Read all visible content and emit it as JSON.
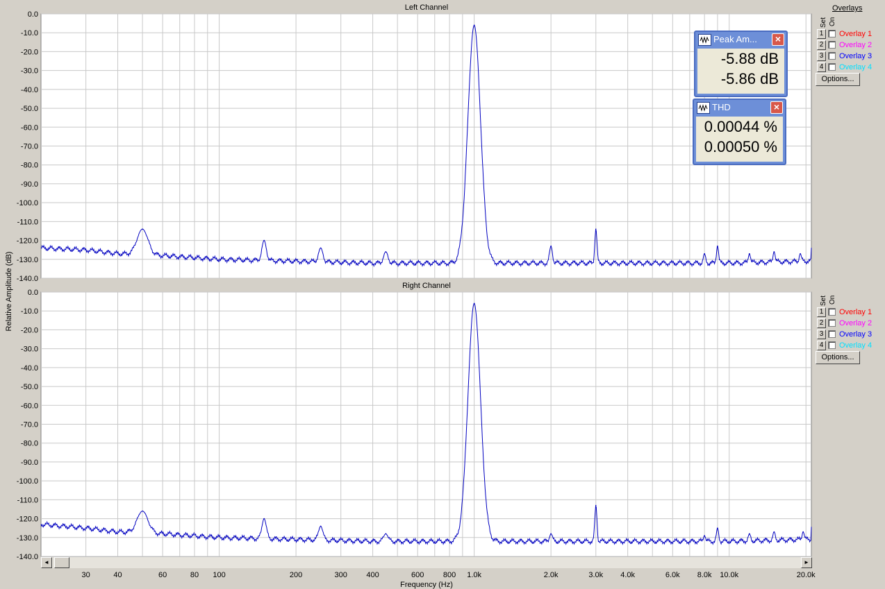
{
  "chart_data": [
    {
      "type": "line",
      "title": "Left Channel",
      "ylabel": "Relative Amplitude (dB)",
      "xscale": "log",
      "xlim": [
        20,
        21000
      ],
      "ylim": [
        -140,
        0
      ],
      "grid": true,
      "series": [
        {
          "name": "",
          "color": "#0000c0",
          "noise": [
            [
              20,
              -124
            ],
            [
              30,
              -125
            ],
            [
              40,
              -127
            ],
            [
              60,
              -128
            ],
            [
              100,
              -130
            ],
            [
              200,
              -131
            ],
            [
              400,
              -132
            ],
            [
              800,
              -132
            ],
            [
              1500,
              -132
            ],
            [
              3000,
              -132
            ],
            [
              6000,
              -132
            ],
            [
              10000,
              -132
            ],
            [
              20000,
              -131
            ],
            [
              21000,
              -131
            ]
          ],
          "peaks": [
            [
              50,
              -114,
              0.03
            ],
            [
              150,
              -120,
              0.012
            ],
            [
              250,
              -124,
              0.012
            ],
            [
              450,
              -126,
              0.012
            ],
            [
              1000,
              -6,
              0.035
            ],
            [
              2000,
              -123,
              0.008
            ],
            [
              3000,
              -114,
              0.006
            ],
            [
              8000,
              -127,
              0.006
            ],
            [
              9000,
              -123,
              0.006
            ],
            [
              12000,
              -127,
              0.006
            ],
            [
              15000,
              -126,
              0.006
            ],
            [
              19000,
              -127,
              0.006
            ]
          ]
        }
      ]
    },
    {
      "type": "line",
      "title": "Right Channel",
      "xlabel": "Frequency (Hz)",
      "ylabel": "Relative Amplitude (dB)",
      "xscale": "log",
      "xlim": [
        20,
        21000
      ],
      "ylim": [
        -140,
        0
      ],
      "grid": true,
      "series": [
        {
          "name": "",
          "color": "#0000c0",
          "noise": [
            [
              20,
              -123
            ],
            [
              30,
              -125
            ],
            [
              40,
              -127
            ],
            [
              60,
              -128
            ],
            [
              100,
              -130
            ],
            [
              200,
              -131
            ],
            [
              400,
              -132
            ],
            [
              800,
              -132
            ],
            [
              1500,
              -132
            ],
            [
              3000,
              -132
            ],
            [
              6000,
              -132
            ],
            [
              10000,
              -132
            ],
            [
              20000,
              -131
            ],
            [
              21000,
              -131
            ]
          ],
          "peaks": [
            [
              50,
              -116,
              0.03
            ],
            [
              150,
              -120,
              0.012
            ],
            [
              250,
              -124,
              0.012
            ],
            [
              450,
              -128,
              0.012
            ],
            [
              1000,
              -6,
              0.035
            ],
            [
              2000,
              -128,
              0.008
            ],
            [
              3000,
              -113,
              0.006
            ],
            [
              8000,
              -129,
              0.006
            ],
            [
              9000,
              -125,
              0.006
            ],
            [
              12000,
              -128,
              0.006
            ],
            [
              15000,
              -127,
              0.006
            ],
            [
              19500,
              -127,
              0.006
            ]
          ]
        }
      ]
    }
  ],
  "y_ticks": [
    "0.0",
    "-10.0",
    "-20.0",
    "-30.0",
    "-40.0",
    "-50.0",
    "-60.0",
    "-70.0",
    "-80.0",
    "-90.0",
    "-100.0",
    "-110.0",
    "-120.0",
    "-130.0",
    "-140.0"
  ],
  "x_ticks": [
    [
      30,
      "30"
    ],
    [
      40,
      "40"
    ],
    [
      60,
      "60"
    ],
    [
      80,
      "80"
    ],
    [
      100,
      "100"
    ],
    [
      200,
      "200"
    ],
    [
      300,
      "300"
    ],
    [
      400,
      "400"
    ],
    [
      600,
      "600"
    ],
    [
      800,
      "800"
    ],
    [
      1000,
      "1.0k"
    ],
    [
      2000,
      "2.0k"
    ],
    [
      3000,
      "3.0k"
    ],
    [
      4000,
      "4.0k"
    ],
    [
      6000,
      "6.0k"
    ],
    [
      8000,
      "8.0k"
    ],
    [
      10000,
      "10.0k"
    ],
    [
      20000,
      "20.0k"
    ]
  ],
  "overlays": {
    "heading": "Overlays",
    "set_label": "Set",
    "on_label": "On",
    "options_label": "Options...",
    "items": [
      {
        "num": "1",
        "label": "Overlay 1",
        "color": "#ff0000"
      },
      {
        "num": "2",
        "label": "Overlay 2",
        "color": "#ff00ff"
      },
      {
        "num": "3",
        "label": "Overlay 3",
        "color": "#0000ff"
      },
      {
        "num": "4",
        "label": "Overlay 4",
        "color": "#00e0ff"
      }
    ]
  },
  "meters": {
    "peak": {
      "title": "Peak Am...",
      "v1": "-5.88 dB",
      "v2": "-5.86 dB"
    },
    "thd": {
      "title": "THD",
      "v1": "0.00044 %",
      "v2": "0.00050 %"
    }
  },
  "scroll": {
    "left": "◄",
    "right": "►"
  }
}
